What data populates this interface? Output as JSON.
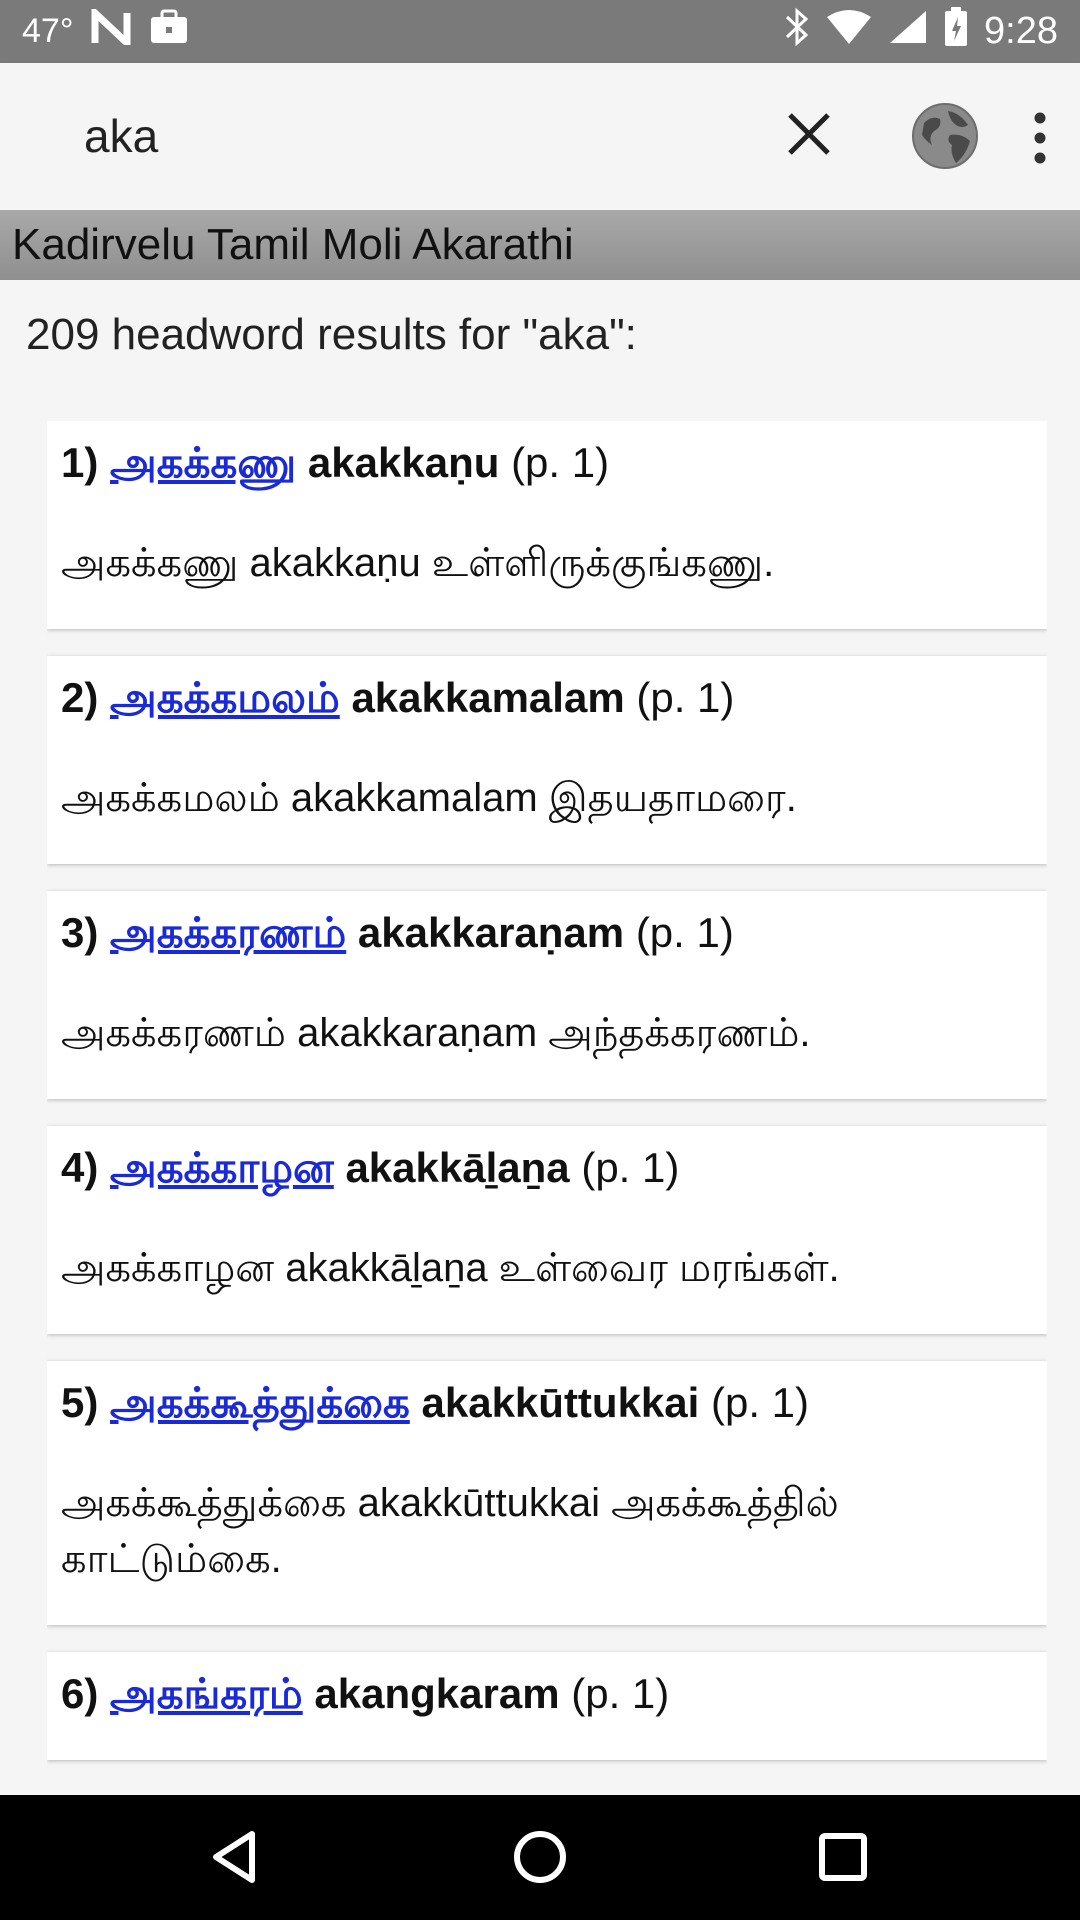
{
  "status_bar": {
    "temperature": "47°",
    "time": "9:28"
  },
  "search": {
    "query": "aka"
  },
  "dictionary": {
    "title": "Kadirvelu Tamil Moli Akarathi"
  },
  "results": {
    "summary": "209 headword results for \"aka\":"
  },
  "entries": [
    {
      "num": "1)",
      "headword": "அகக்கணு",
      "translit": "akakkaṇu",
      "page": "(p. 1)",
      "definition": "அகக்கணு akakkaṇu உள்ளிருக்குங்கணு."
    },
    {
      "num": "2)",
      "headword": "அகக்கமலம்",
      "translit": "akakkamalam",
      "page": "(p. 1)",
      "definition": "அகக்கமலம் akakkamalam இதயதாமரை."
    },
    {
      "num": "3)",
      "headword": "அகக்கரணம்",
      "translit": "akakkaraṇam",
      "page": "(p. 1)",
      "definition": "அகக்கரணம் akakkaraṇam அந்தக்கரணம்."
    },
    {
      "num": "4)",
      "headword": "அகக்காழன",
      "translit": "akakkāḻaṉa",
      "page": "(p. 1)",
      "definition": "அகக்காழன akakkāḻaṉa உள்வைர மரங்கள்."
    },
    {
      "num": "5)",
      "headword": "அகக்கூத்துக்கை",
      "translit": "akakkūttukkai",
      "page": "(p. 1)",
      "definition": "அகக்கூத்துக்கை akakkūttukkai அகக்கூத்தில் காட்டும்கை."
    },
    {
      "num": "6)",
      "headword": "அகங்கரம்",
      "translit": "akangkaram",
      "page": "(p. 1)",
      "definition": ""
    }
  ],
  "icons": {
    "clear": "close-icon",
    "globe": "globe-icon",
    "more": "more-vert-icon",
    "back": "nav-back-icon",
    "home": "nav-home-icon",
    "recents": "nav-recents-icon"
  }
}
